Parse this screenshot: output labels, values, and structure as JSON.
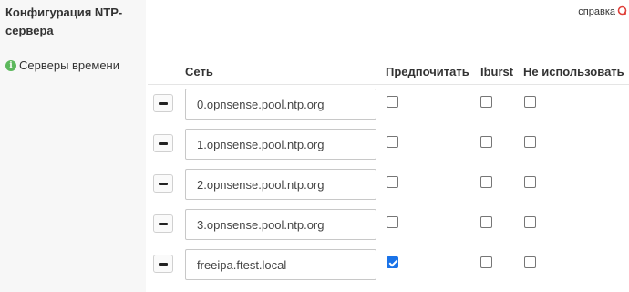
{
  "section": {
    "title": "Конфигурация NTP-сервера",
    "field_label": "Серверы времени"
  },
  "help": {
    "label": "справка",
    "icon": "toggle-circle-icon",
    "icon_color": "#e0403a"
  },
  "table": {
    "headers": {
      "network": "Сеть",
      "prefer": "Предпочитать",
      "iburst": "Iburst",
      "noselect": "Не использовать"
    },
    "rows": [
      {
        "server": "0.opnsense.pool.ntp.org",
        "prefer": false,
        "iburst": false,
        "noselect": false
      },
      {
        "server": "1.opnsense.pool.ntp.org",
        "prefer": false,
        "iburst": false,
        "noselect": false
      },
      {
        "server": "2.opnsense.pool.ntp.org",
        "prefer": false,
        "iburst": false,
        "noselect": false
      },
      {
        "server": "3.opnsense.pool.ntp.org",
        "prefer": false,
        "iburst": false,
        "noselect": false
      },
      {
        "server": "freeipa.ftest.local",
        "prefer": true,
        "iburst": false,
        "noselect": false
      }
    ]
  },
  "colors": {
    "checkbox_checked": "#1a73e8",
    "info_icon": "#5cb85c"
  }
}
